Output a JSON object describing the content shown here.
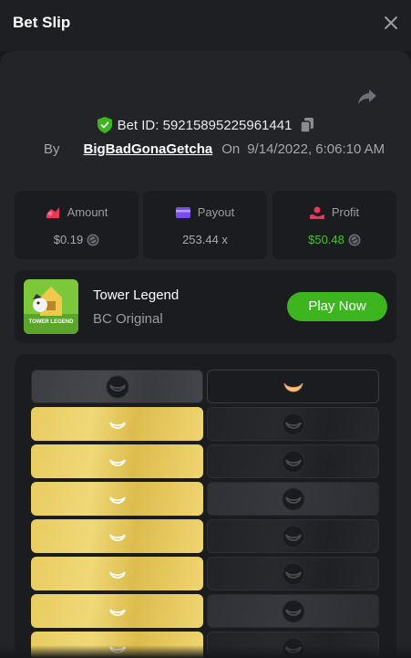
{
  "header": {
    "title": "Bet Slip"
  },
  "bet": {
    "id_label": "Bet ID: 59215895225961441",
    "by_label": "By",
    "username": "BigBadGonaGetcha",
    "on_label": "On",
    "datetime": "9/14/2022, 6:06:10 AM"
  },
  "stats": {
    "amount": {
      "label": "Amount",
      "value": "$0.19"
    },
    "payout": {
      "label": "Payout",
      "value": "253.44 x"
    },
    "profit": {
      "label": "Profit",
      "value": "$50.48"
    }
  },
  "game": {
    "name": "Tower Legend",
    "subtitle": "BC Original",
    "thumb_text": "TOWER LEGEND",
    "play_label": "Play Now"
  },
  "board": {
    "rows": [
      {
        "left": "grey-banana",
        "right": "outline-banana"
      },
      {
        "left": "gold-banana",
        "right": "dark-banana"
      },
      {
        "left": "gold-banana",
        "right": "dark-banana"
      },
      {
        "left": "gold-banana",
        "right": "dim-banana"
      },
      {
        "left": "gold-banana",
        "right": "dark-banana"
      },
      {
        "left": "gold-banana",
        "right": "dark-banana"
      },
      {
        "left": "gold-banana",
        "right": "dim-banana"
      },
      {
        "left": "gold-banana",
        "right": "dark-banana"
      }
    ]
  },
  "colors": {
    "accent_green": "#3db51f",
    "profit_green": "#46c22e",
    "gold_tile": "#e8cc60",
    "panel": "#232427",
    "card": "#1b1c1f"
  },
  "icons": {
    "close": "close-icon",
    "share": "share-icon",
    "verified": "shield-check-icon",
    "copy": "copy-icon",
    "amount": "amount-icon",
    "payout": "payout-icon",
    "profit": "profit-icon",
    "coin": "coin-icon",
    "tile": "banana-icon"
  }
}
